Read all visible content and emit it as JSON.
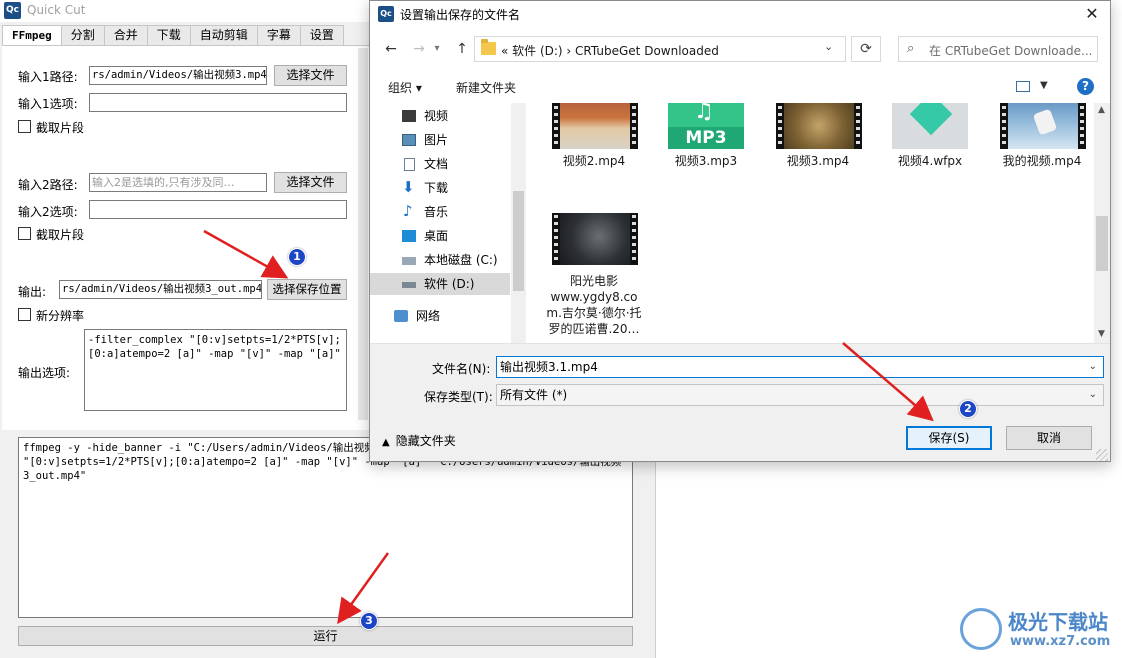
{
  "quickcut": {
    "logo": "Qc",
    "title": "Quick Cut",
    "tabs": [
      "FFmpeg",
      "分割",
      "合并",
      "下载",
      "自动剪辑",
      "字幕",
      "设置"
    ],
    "input1": {
      "path_label": "输入1路径:",
      "path_value": "rs/admin/Videos/输出视频3.mp4",
      "choose_button": "选择文件",
      "options_label": "输入1选项:",
      "options_value": "",
      "clip_label": "截取片段"
    },
    "input2": {
      "path_label": "输入2路径:",
      "path_placeholder": "输入2是选填的,只有涉及同…",
      "choose_button": "选择文件",
      "options_label": "输入2选项:",
      "options_value": "",
      "clip_label": "截取片段"
    },
    "output": {
      "label": "输出:",
      "value": "rs/admin/Videos/输出视频3_out.mp4",
      "choose_button": "选择保存位置",
      "resolution_label": "新分辨率",
      "options_label": "输出选项:",
      "options_value": "-filter_complex \"[0:v]setpts=1/2*PTS[v];\n[0:a]atempo=2 [a]\" -map \"[v]\" -map \"[a]\""
    },
    "command_text": "ffmpeg -y -hide_banner -i \"C:/Users/admin/Videos/输出视频3\n\"[0:v]setpts=1/2*PTS[v];[0:a]atempo=2 [a]\" -map \"[v]\" -map \"[a]\" \"C:/Users/admin/Videos/输出视频\n3_out.mp4\"",
    "run_button": "运行"
  },
  "dialog": {
    "logo": "Qc",
    "title": "设置输出保存的文件名",
    "close_glyph": "✕",
    "nav": {
      "back": "←",
      "forward": "→",
      "up": "↑"
    },
    "address": "«  软件 (D:)  ›  CRTubeGet Downloaded",
    "refresh_glyph": "⟳",
    "search_placeholder": "在 CRTubeGet Downloade...",
    "toolbar": {
      "organize": "组织 ▾",
      "new_folder": "新建文件夹",
      "help": "?"
    },
    "nav_items": [
      {
        "label": "视频",
        "icon": "video-folder-icon"
      },
      {
        "label": "图片",
        "icon": "pictures-folder-icon"
      },
      {
        "label": "文档",
        "icon": "documents-folder-icon"
      },
      {
        "label": "下载",
        "icon": "download-folder-icon"
      },
      {
        "label": "音乐",
        "icon": "music-folder-icon"
      },
      {
        "label": "桌面",
        "icon": "desktop-folder-icon"
      },
      {
        "label": "本地磁盘 (C:)",
        "icon": "drive-c-icon"
      },
      {
        "label": "软件 (D:)",
        "icon": "drive-d-icon"
      },
      {
        "label": "网络",
        "icon": "network-icon"
      }
    ],
    "files": [
      {
        "name": "视频2.mp4",
        "kind": "video"
      },
      {
        "name": "视频3.mp3",
        "kind": "mp3",
        "badge": "MP3"
      },
      {
        "name": "视频3.mp4",
        "kind": "video"
      },
      {
        "name": "视频4.wfpx",
        "kind": "wfpx"
      },
      {
        "name": "我的视频.mp4",
        "kind": "video"
      },
      {
        "name": "阳光电影\nwww.ygdy8.co\nm.吉尔莫·德尔·托\n罗的匹诺曹.20…",
        "kind": "video"
      }
    ],
    "filename_label": "文件名(N):",
    "filename_value": "输出视频3.1.mp4",
    "filetype_label": "保存类型(T):",
    "filetype_value": "所有文件 (*)",
    "hide_folders": "隐藏文件夹",
    "save_button": "保存(S)",
    "cancel_button": "取消"
  },
  "annotations": [
    "1",
    "2",
    "3"
  ],
  "colors": {
    "arrow": "#e02020",
    "badge": "#1d46c6",
    "accent": "#0078d7"
  },
  "watermark": {
    "name": "极光下载站",
    "url": "www.xz7.com"
  }
}
